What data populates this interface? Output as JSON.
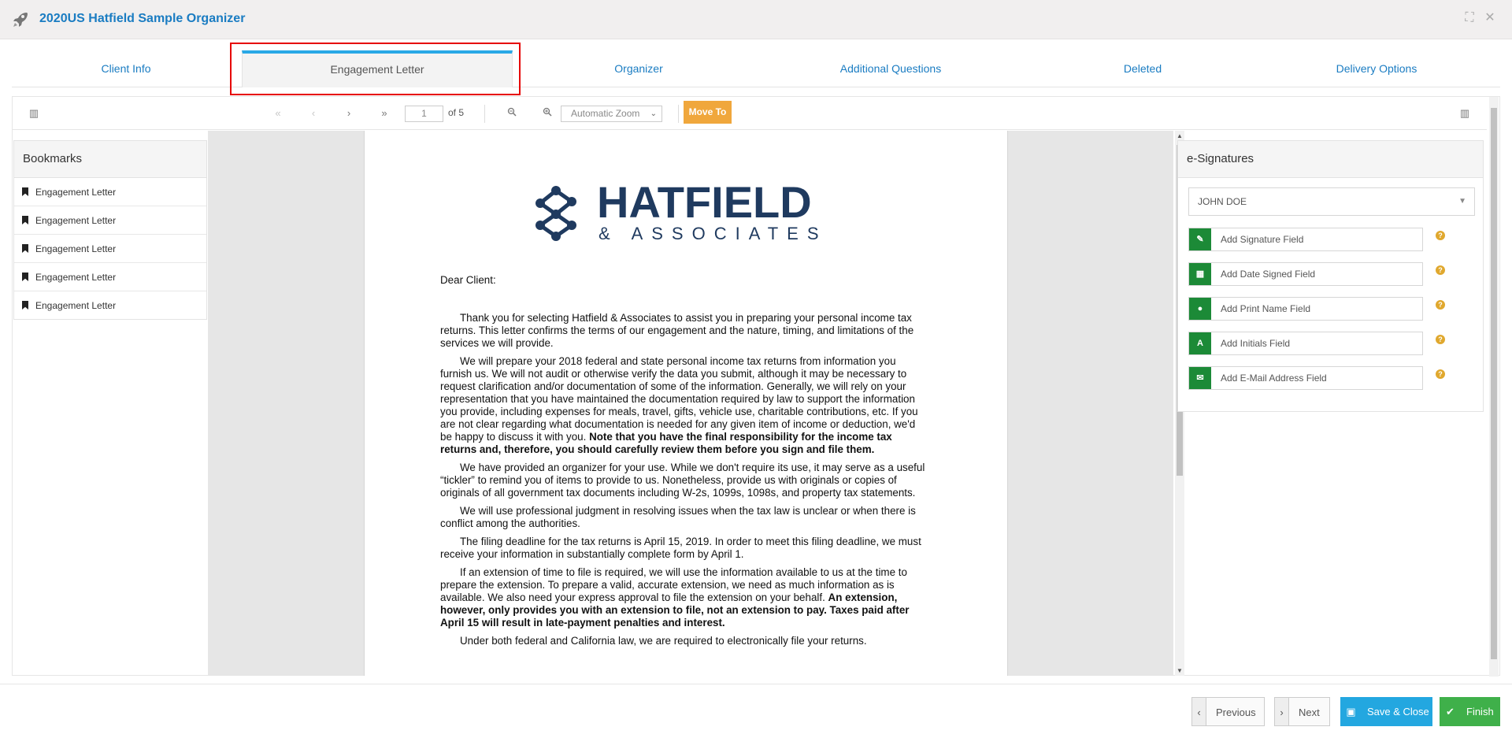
{
  "window": {
    "title": "2020US Hatfield Sample Organizer",
    "icons": [
      "rocket-icon",
      "expand-icon",
      "close-icon"
    ]
  },
  "tabs": [
    {
      "label": "Client Info"
    },
    {
      "label": "Engagement Letter",
      "active": true
    },
    {
      "label": "Organizer"
    },
    {
      "label": "Additional Questions"
    },
    {
      "label": "Deleted"
    },
    {
      "label": "Delivery Options"
    }
  ],
  "toolbar": {
    "first": "«",
    "prev": "‹",
    "next": "›",
    "last": "»",
    "page_value": "1",
    "page_of": "of 5",
    "zoom_out": "−",
    "zoom_in": "+",
    "zoom_value": "Automatic Zoom",
    "move_to": "Move To"
  },
  "bookmarks": {
    "header": "Bookmarks",
    "items": [
      {
        "label": "Engagement Letter"
      },
      {
        "label": "Engagement Letter"
      },
      {
        "label": "Engagement Letter"
      },
      {
        "label": "Engagement Letter"
      },
      {
        "label": "Engagement Letter"
      }
    ]
  },
  "document": {
    "logo_name": "HATFIELD",
    "logo_sub": "& ASSOCIATES",
    "greeting": "Dear Client:",
    "p1": "Thank you for selecting Hatfield & Associates to assist you in preparing your personal income tax returns. This letter confirms the terms of our engagement and the nature, timing, and limitations of the services we will provide.",
    "p2": "We will prepare your 2018 federal and state personal income tax returns from information you furnish us. We will not audit or otherwise verify the data you submit, although it may be necessary to request clarification and/or documentation of some of the information. Generally, we will rely on your representation that you have maintained the documentation required by law to support the information you provide, including expenses for meals, travel, gifts, vehicle use, charitable contributions, etc. If you are not clear regarding what documentation is needed for any given item of income or deduction, we'd be happy to discuss it with you.",
    "p2_bold": "Note that you have the final responsibility for the income tax returns and, therefore, you should carefully review them before you sign and file them.",
    "p3": "We have provided an organizer for your use. While we don't require its use, it may serve as a useful “tickler” to remind you of items to provide to us. Nonetheless, provide us with originals or copies of originals of all government tax documents including W-2s, 1099s, 1098s, and property tax statements.",
    "p4": "We will use professional judgment in resolving issues when the tax law is unclear or when there is conflict among the authorities.",
    "p5": "The filing deadline for the tax returns is April 15, 2019. In order to meet this filing deadline, we must receive your information in substantially complete form by April 1.",
    "p6": "If an extension of time to file is required, we will use the information available to us at the time to prepare the extension. To prepare a valid, accurate extension, we need as much information as is available. We also need your express approval to file the extension on your behalf.",
    "p6_bold": "An extension, however, only provides you with an extension to file, not an extension to pay. Taxes paid after April 15 will result in late-payment penalties and interest.",
    "p7": "Under both federal and California law, we are required to electronically file your returns."
  },
  "esignatures": {
    "header": "e-Signatures",
    "signer": "JOHN DOE",
    "fields": [
      {
        "label": "Add Signature Field",
        "icon": "signature-icon",
        "glyph": "✎"
      },
      {
        "label": "Add Date Signed Field",
        "icon": "calendar-icon",
        "glyph": "▦"
      },
      {
        "label": "Add Print Name Field",
        "icon": "user-icon",
        "glyph": "●"
      },
      {
        "label": "Add Initials Field",
        "icon": "initials-icon",
        "glyph": "A"
      },
      {
        "label": "Add E-Mail Address Field",
        "icon": "envelope-icon",
        "glyph": "✉"
      }
    ],
    "help_glyph": "?"
  },
  "footer": {
    "previous": "Previous",
    "next": "Next",
    "save_close": "Save & Close",
    "finish": "Finish"
  },
  "colors": {
    "accent": "#1a7cc2",
    "tab_active_bar": "#29a8e6",
    "move_to": "#f0a73c",
    "field_icon": "#1c8a37",
    "save": "#23a7e0",
    "finish": "#3fb04a",
    "highlight": "#e60000"
  }
}
